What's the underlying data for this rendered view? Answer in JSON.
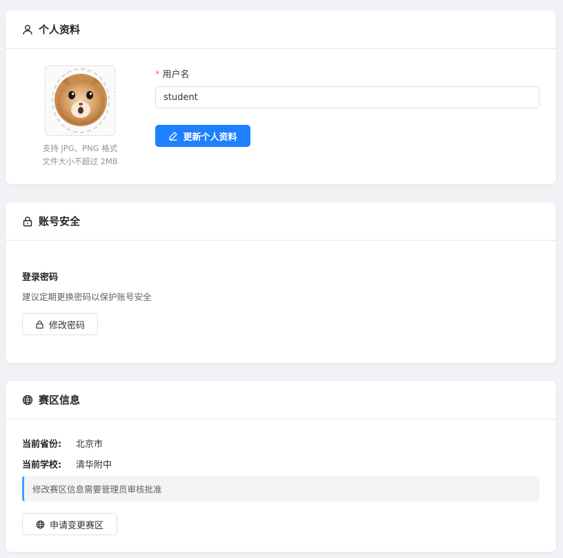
{
  "profile": {
    "title": "个人资料",
    "avatar_hint_line1": "支持 JPG、PNG 格式",
    "avatar_hint_line2": "文件大小不超过 2MB",
    "required_mark": "*",
    "username_label": "用户名",
    "username_value": "student",
    "update_button": "更新个人资料"
  },
  "security": {
    "title": "账号安全",
    "password_title": "登录密码",
    "password_desc": "建议定期更换密码以保护账号安全",
    "change_password_button": "修改密码"
  },
  "region": {
    "title": "赛区信息",
    "province_label": "当前省份:",
    "province_value": "北京市",
    "school_label": "当前学校:",
    "school_value": "清华附中",
    "notice": "修改赛区信息需要管理员审核批准",
    "request_button": "申请变更赛区"
  },
  "colors": {
    "primary": "#1e80ff",
    "notice_border": "#409eff",
    "required": "#f56c6c"
  },
  "icons": {
    "profile": "user-icon",
    "security": "lock-icon",
    "region": "globe-icon",
    "edit": "edit-icon"
  }
}
